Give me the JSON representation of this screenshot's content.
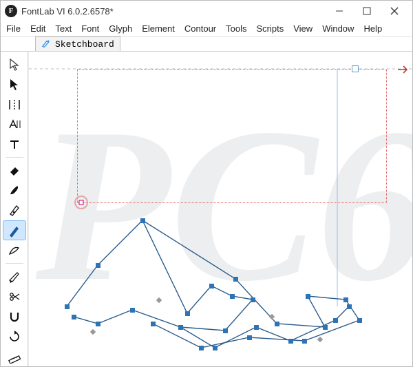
{
  "titlebar": {
    "app_glyph": "F",
    "title": "FontLab VI 6.0.2.6578*"
  },
  "menu": {
    "items": [
      "File",
      "Edit",
      "Text",
      "Font",
      "Glyph",
      "Element",
      "Contour",
      "Tools",
      "Scripts",
      "View",
      "Window",
      "Help"
    ]
  },
  "tabs": {
    "items": [
      {
        "label": "Sketchboard"
      }
    ]
  },
  "tools": {
    "selected_index": 8,
    "items": [
      "pointer-outline",
      "pointer-fill",
      "guides",
      "metrics",
      "text",
      "eraser",
      "brush",
      "pen",
      "pencil",
      "calligraphy",
      "knife",
      "scissors",
      "magnet",
      "rotate",
      "ruler"
    ]
  },
  "canvas": {
    "background_text": "PC6",
    "colors": {
      "selection_outline": "#e05a5a",
      "bezier_stroke": "#2b5d8c",
      "node_fill": "#2e74b5"
    }
  }
}
